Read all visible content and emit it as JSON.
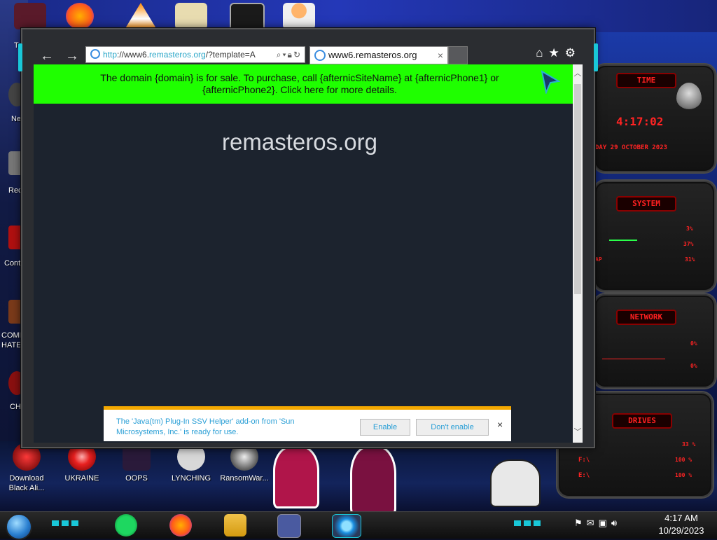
{
  "desktop": {
    "icons_bottom": [
      {
        "label": "Download Black Ali..."
      },
      {
        "label": "UKRAINE"
      },
      {
        "label": "OOPS"
      },
      {
        "label": "LYNCHING"
      },
      {
        "label": "RansomWar..."
      }
    ],
    "side_labels": [
      "Ne",
      "Rec",
      "Cont",
      "COMM HATE",
      "CH"
    ],
    "top_left_label": "T"
  },
  "widgets": {
    "time": {
      "header": "TIME",
      "clock": "4:17:02",
      "date": "DAY 29 OCTOBER 2023"
    },
    "system": {
      "header": "SYSTEM",
      "rows": [
        {
          "label": "",
          "value": "3%"
        },
        {
          "label": "",
          "value": "37%"
        },
        {
          "label": "AP",
          "value": "31%"
        }
      ]
    },
    "network": {
      "header": "NETWORK",
      "rows": [
        {
          "value": "0%"
        },
        {
          "value": "0%"
        }
      ]
    },
    "drives": {
      "header": "DRIVES",
      "rows": [
        {
          "label": "",
          "value": "33 %"
        },
        {
          "label": "F:\\",
          "value": "100 %"
        },
        {
          "label": "E:\\",
          "value": "100 %"
        }
      ]
    }
  },
  "browser": {
    "address": {
      "scheme": "http",
      "mid": "://www6.",
      "host": "remasteros.org",
      "rest": "/?template=A"
    },
    "tab_title": "www6.remasteros.org",
    "tab_close": "×",
    "toolbar_icons": [
      "home-icon",
      "star-icon",
      "gear-icon"
    ],
    "banner_text": "The domain {domain} is for sale. To purchase, call {afternicSiteName} at {afternicPhone1} or {afternicPhone2}. Click here for more details.",
    "site_title": "remasteros.org"
  },
  "notification": {
    "message": "The 'Java(tm) Plug-In SSV Helper' add-on from 'Sun Microsystems, Inc.' is ready for use.",
    "enable_label": "Enable",
    "dont_enable_label": "Don't enable",
    "close_label": "×"
  },
  "taskbar": {
    "apps": [
      "spotify",
      "firefox",
      "file-explorer",
      "control-panel",
      "internet-explorer"
    ],
    "time": "4:17 AM",
    "date": "10/29/2023"
  },
  "colors": {
    "banner": "#1fff00",
    "accent_cyan": "#19c7d8",
    "widget_red": "#ff2323",
    "notify_link": "#2a9fd6",
    "notify_border": "#f4a800"
  }
}
